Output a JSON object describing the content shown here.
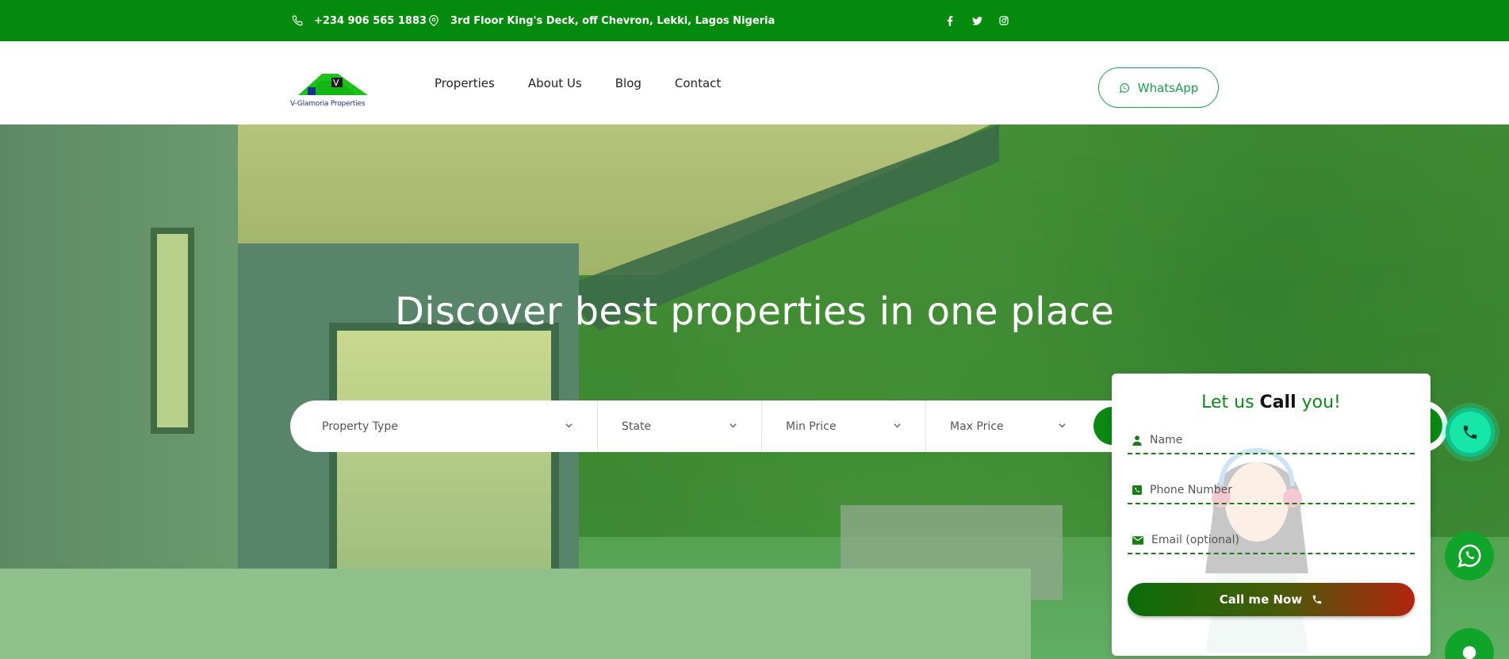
{
  "topbar": {
    "phone": "+234 906 565 1883",
    "address": "3rd Floor King's Deck, off Chevron, Lekki, Lagos Nigeria",
    "social": [
      "facebook-icon",
      "twitter-icon",
      "instagram-icon"
    ]
  },
  "header": {
    "logo_text": "V-Glamoria Properties",
    "nav": [
      "Properties",
      "About Us",
      "Blog",
      "Contact"
    ],
    "whatsapp_label": "WhatsApp"
  },
  "hero": {
    "title": "Discover best properties in one place"
  },
  "search": {
    "property_type": "Property Type",
    "state": "State",
    "min_price": "Min Price",
    "max_price": "Max Price"
  },
  "callback": {
    "title_pre": "Let us ",
    "title_bold": "Call",
    "title_post": " you!",
    "name_placeholder": "Name",
    "phone_placeholder": "Phone Number",
    "email_placeholder": "Email (optional)",
    "submit_label": "Call me Now"
  },
  "colors": {
    "brand_green": "#048a0c",
    "accent_green": "#16a34a",
    "call_gradient_end": "#b3240f",
    "fab_phone": "#16e6a6"
  }
}
